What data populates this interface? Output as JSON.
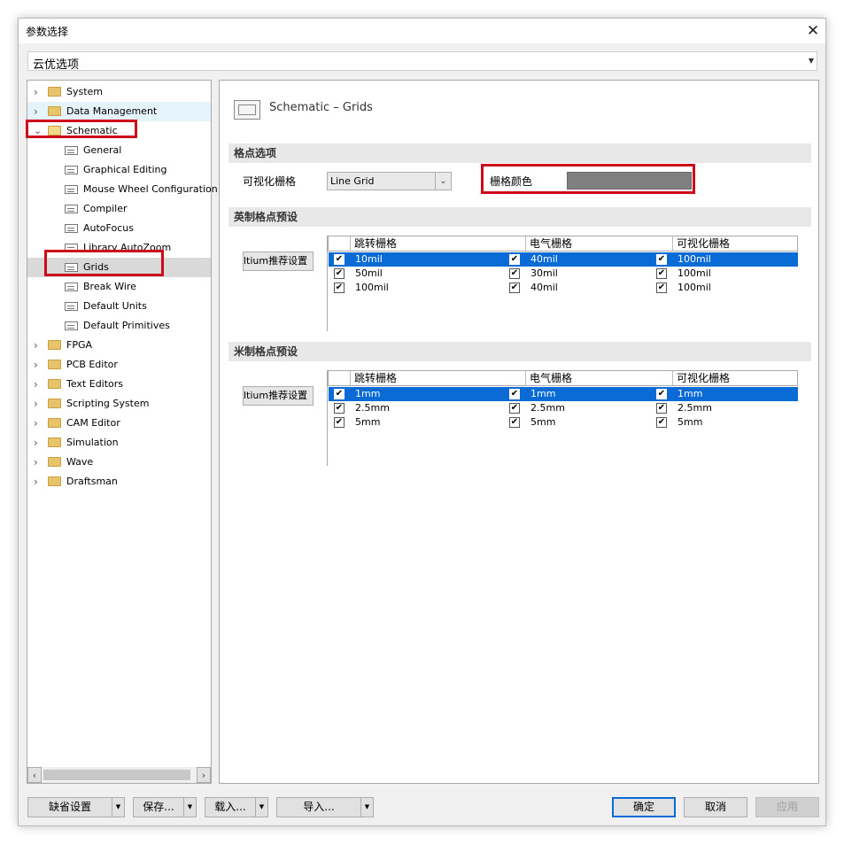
{
  "window": {
    "title": "参数选择",
    "close_icon": "close-icon"
  },
  "profile": {
    "value": "云优选项"
  },
  "tree": {
    "items": [
      {
        "label": "System",
        "type": "folder",
        "expanded": false
      },
      {
        "label": "Data Management",
        "type": "folder",
        "expanded": false
      },
      {
        "label": "Schematic",
        "type": "folder",
        "expanded": true
      },
      {
        "label": "General",
        "type": "page"
      },
      {
        "label": "Graphical Editing",
        "type": "page"
      },
      {
        "label": "Mouse Wheel Configuration",
        "type": "page"
      },
      {
        "label": "Compiler",
        "type": "page"
      },
      {
        "label": "AutoFocus",
        "type": "page"
      },
      {
        "label": "Library AutoZoom",
        "type": "page"
      },
      {
        "label": "Grids",
        "type": "page",
        "selected": true
      },
      {
        "label": "Break Wire",
        "type": "page"
      },
      {
        "label": "Default Units",
        "type": "page"
      },
      {
        "label": "Default Primitives",
        "type": "page"
      },
      {
        "label": "FPGA",
        "type": "folder",
        "expanded": false
      },
      {
        "label": "PCB Editor",
        "type": "folder",
        "expanded": false
      },
      {
        "label": "Text Editors",
        "type": "folder",
        "expanded": false
      },
      {
        "label": "Scripting System",
        "type": "folder",
        "expanded": false
      },
      {
        "label": "CAM Editor",
        "type": "folder",
        "expanded": false
      },
      {
        "label": "Simulation",
        "type": "folder",
        "expanded": false
      },
      {
        "label": "Wave",
        "type": "folder",
        "expanded": false
      },
      {
        "label": "Draftsman",
        "type": "folder",
        "expanded": false
      }
    ]
  },
  "content": {
    "page_title": "Schematic – Grids",
    "grid_options": {
      "section": "格点选项",
      "visible_grid_label": "可视化栅格",
      "visible_grid_value": "Line Grid",
      "grid_color_label": "栅格颜色",
      "grid_color": "#808080"
    },
    "imperial": {
      "section": "英制格点预设",
      "preset_button": "ltium推荐设置",
      "columns": [
        "跳转栅格",
        "电气栅格",
        "可视化栅格"
      ],
      "rows": [
        {
          "snap": "10mil",
          "electrical": "40mil",
          "visible": "100mil",
          "selected": true
        },
        {
          "snap": "50mil",
          "electrical": "30mil",
          "visible": "100mil",
          "selected": false
        },
        {
          "snap": "100mil",
          "electrical": "40mil",
          "visible": "100mil",
          "selected": false
        }
      ]
    },
    "metric": {
      "section": "米制格点预设",
      "preset_button": "ltium推荐设置",
      "columns": [
        "跳转栅格",
        "电气栅格",
        "可视化栅格"
      ],
      "rows": [
        {
          "snap": "1mm",
          "electrical": "1mm",
          "visible": "1mm",
          "selected": true
        },
        {
          "snap": "2.5mm",
          "electrical": "2.5mm",
          "visible": "2.5mm",
          "selected": false
        },
        {
          "snap": "5mm",
          "electrical": "5mm",
          "visible": "5mm",
          "selected": false
        }
      ]
    }
  },
  "footer": {
    "defaults": "缺省设置",
    "save": "保存...",
    "load": "载入...",
    "import": "导入...",
    "ok": "确定",
    "cancel": "取消",
    "apply": "应用"
  },
  "colors": {
    "selection": "#0a6ad6",
    "highlight_box": "#cc0a1a"
  }
}
